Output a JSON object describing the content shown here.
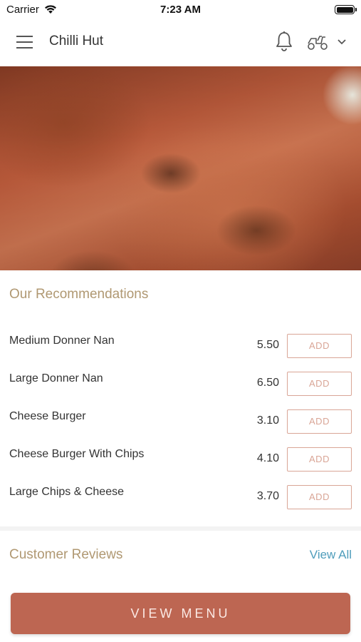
{
  "status_bar": {
    "carrier": "Carrier",
    "time": "7:23 AM"
  },
  "header": {
    "title": "Chilli Hut",
    "icons": [
      "menu-icon",
      "bell-icon",
      "scooter-icon",
      "chevron-down-icon"
    ]
  },
  "recommendations": {
    "title": "Our Recommendations",
    "add_label": "ADD",
    "items": [
      {
        "name": "Medium Donner Nan",
        "price": "5.50"
      },
      {
        "name": "Large Donner Nan",
        "price": "6.50"
      },
      {
        "name": "Cheese Burger",
        "price": "3.10"
      },
      {
        "name": "Cheese Burger With Chips",
        "price": "4.10"
      },
      {
        "name": "Large Chips & Cheese",
        "price": "3.70"
      }
    ]
  },
  "reviews": {
    "title": "Customer Reviews",
    "view_all": "View All"
  },
  "footer": {
    "view_menu_label": "VIEW MENU"
  },
  "colors": {
    "accent": "#bd6652",
    "section_title": "#b09872",
    "link": "#4f9dbb",
    "add_border": "#d9a596"
  }
}
